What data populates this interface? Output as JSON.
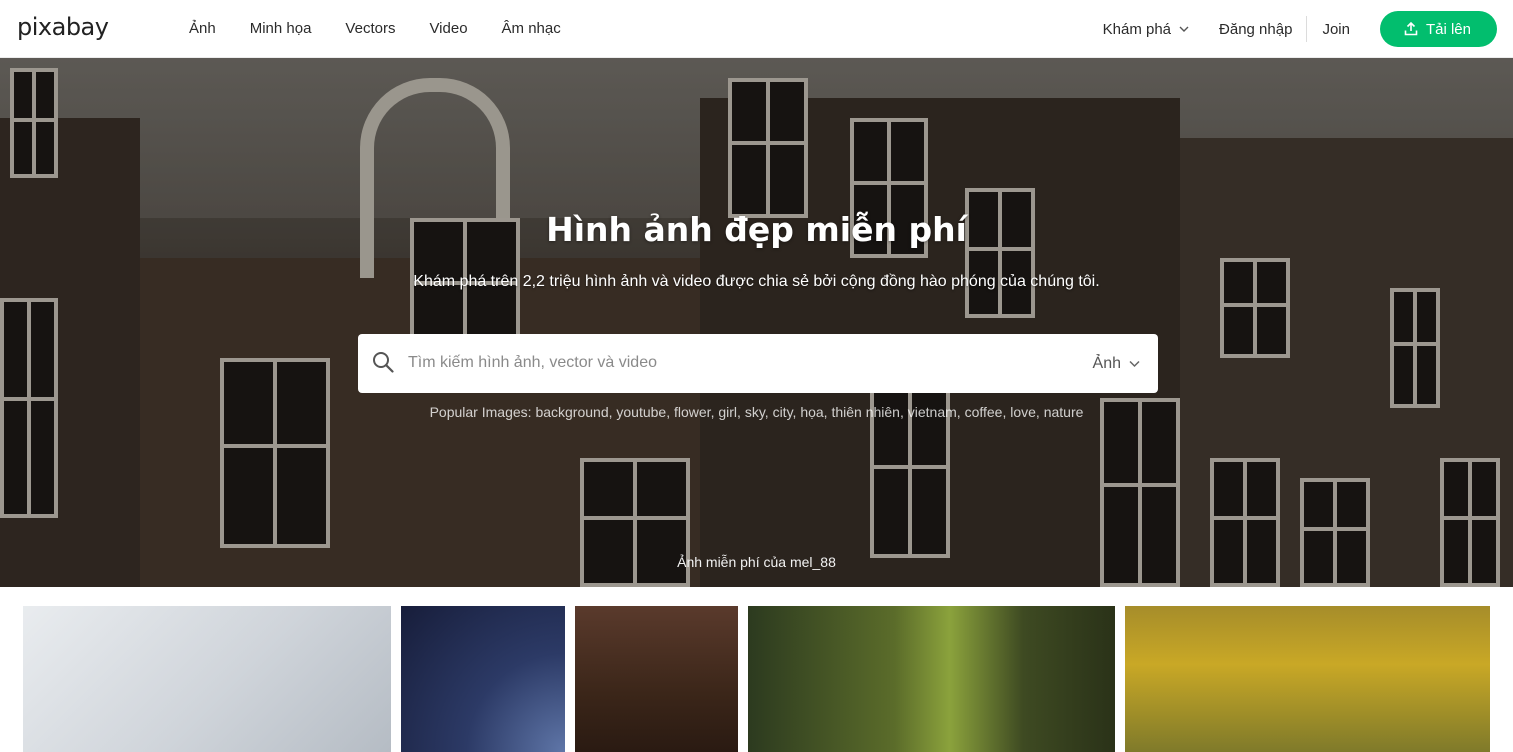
{
  "header": {
    "logo": "pixabay",
    "nav": [
      "Ảnh",
      "Minh họa",
      "Vectors",
      "Video",
      "Âm nhạc"
    ],
    "explore_label": "Khám phá",
    "login_label": "Đăng nhập",
    "join_label": "Join",
    "upload_label": "Tải lên"
  },
  "hero": {
    "title": "Hình ảnh đẹp miễn phí",
    "subtitle": "Khám phá trên 2,2 triệu hình ảnh và video được chia sẻ bởi cộng đồng hào phóng của chúng tôi.",
    "search_placeholder": "Tìm kiếm hình ảnh, vector và video",
    "search_type": "Ảnh",
    "popular_label": "Popular Images:",
    "popular_tags": [
      "background",
      "youtube",
      "flower",
      "girl",
      "sky",
      "city",
      "họa",
      "thiên nhiên",
      "vietnam",
      "coffee",
      "love",
      "nature"
    ],
    "credit": "Ảnh miễn phí của mel_88"
  },
  "colors": {
    "accent": "#02be6e"
  },
  "icons": {
    "upload": "upload-icon",
    "search": "search-icon",
    "chevron": "chevron-down-icon"
  }
}
